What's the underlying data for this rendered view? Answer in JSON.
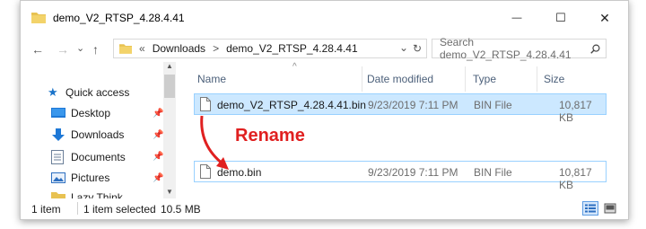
{
  "window": {
    "title": "demo_V2_RTSP_4.28.4.41",
    "minimize_glyph": "—",
    "maximize_glyph": "☐",
    "close_glyph": "✕"
  },
  "nav": {
    "back": "←",
    "forward": "→",
    "recent": "⌄",
    "up": "↑",
    "breadcrumb_overflow": "«",
    "breadcrumb": [
      "Downloads",
      "demo_V2_RTSP_4.28.4.41"
    ],
    "crumb_sep": ">",
    "dropdown": "⌄",
    "refresh": "↻",
    "search_placeholder": "Search demo_V2_RTSP_4.28.4.41"
  },
  "sidebar": {
    "items": [
      {
        "label": "Quick access",
        "icon": "star-icon",
        "pinned": false
      },
      {
        "label": "Desktop",
        "icon": "desktop-icon",
        "pinned": true
      },
      {
        "label": "Downloads",
        "icon": "download-icon",
        "pinned": true
      },
      {
        "label": "Documents",
        "icon": "documents-icon",
        "pinned": true
      },
      {
        "label": "Pictures",
        "icon": "pictures-icon",
        "pinned": true
      },
      {
        "label": "Lazy Think",
        "icon": "folder-icon",
        "pinned": false
      }
    ],
    "pin_glyph": "📌"
  },
  "columns": {
    "name": "Name",
    "date": "Date modified",
    "type": "Type",
    "size": "Size",
    "sort_glyph": "^"
  },
  "files": [
    {
      "name": "demo_V2_RTSP_4.28.4.41.bin",
      "date": "9/23/2019 7:11 PM",
      "type": "BIN File",
      "size": "10,817 KB"
    },
    {
      "name": "demo.bin",
      "date": "9/23/2019 7:11 PM",
      "type": "BIN File",
      "size": "10,817 KB"
    }
  ],
  "annotation": {
    "text": "Rename",
    "color": "#e02020"
  },
  "status": {
    "count": "1 item",
    "selected": "1 item selected",
    "size": "10.5 MB"
  },
  "colors": {
    "selection": "#cce8ff",
    "selection_border": "#99d1ff",
    "folder": "#e8c252",
    "accent": "#1a73c9"
  }
}
